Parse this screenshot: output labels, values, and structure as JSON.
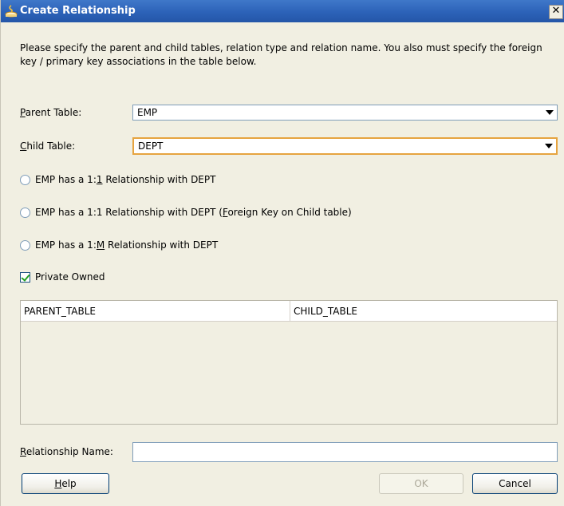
{
  "window": {
    "title": "Create Relationship",
    "close_glyph": "✕"
  },
  "instructions": "Please specify the parent and child tables, relation type and relation name.  You also must specify the foreign key / primary key associations in the table below.",
  "parent_table": {
    "label_access_key": "P",
    "label_rest": "arent Table:",
    "value": "EMP"
  },
  "child_table": {
    "label_access_key": "C",
    "label_rest": "hild Table:",
    "value": "DEPT"
  },
  "relation_options": [
    {
      "pre": "EMP has a 1:",
      "key": "1",
      "post": " Relationship with DEPT",
      "selected": false
    },
    {
      "pre": "EMP has a 1:1 Relationship with DEPT (",
      "key": "F",
      "post": "oreign Key on Child table)",
      "selected": false
    },
    {
      "pre": "EMP has a 1:",
      "key": "M",
      "post": " Relationship with DEPT",
      "selected": false
    }
  ],
  "private_owned": {
    "label": "Private Owned",
    "checked": true
  },
  "mapping_table": {
    "columns": [
      "PARENT_TABLE",
      "CHILD_TABLE"
    ],
    "rows": []
  },
  "relationship_name": {
    "label_access_key": "R",
    "label_rest": "elationship Name:",
    "value": ""
  },
  "buttons": {
    "help_key": "H",
    "help_rest": "elp",
    "ok": "OK",
    "cancel": "Cancel"
  },
  "colors": {
    "titlebar": "#2c62b8",
    "dialog_bg": "#f1efe2",
    "focus_border": "#e6a440",
    "checkmark": "#21a121"
  },
  "icons": {
    "title": "oracle-app-icon",
    "combo": "chevron-down-icon"
  }
}
